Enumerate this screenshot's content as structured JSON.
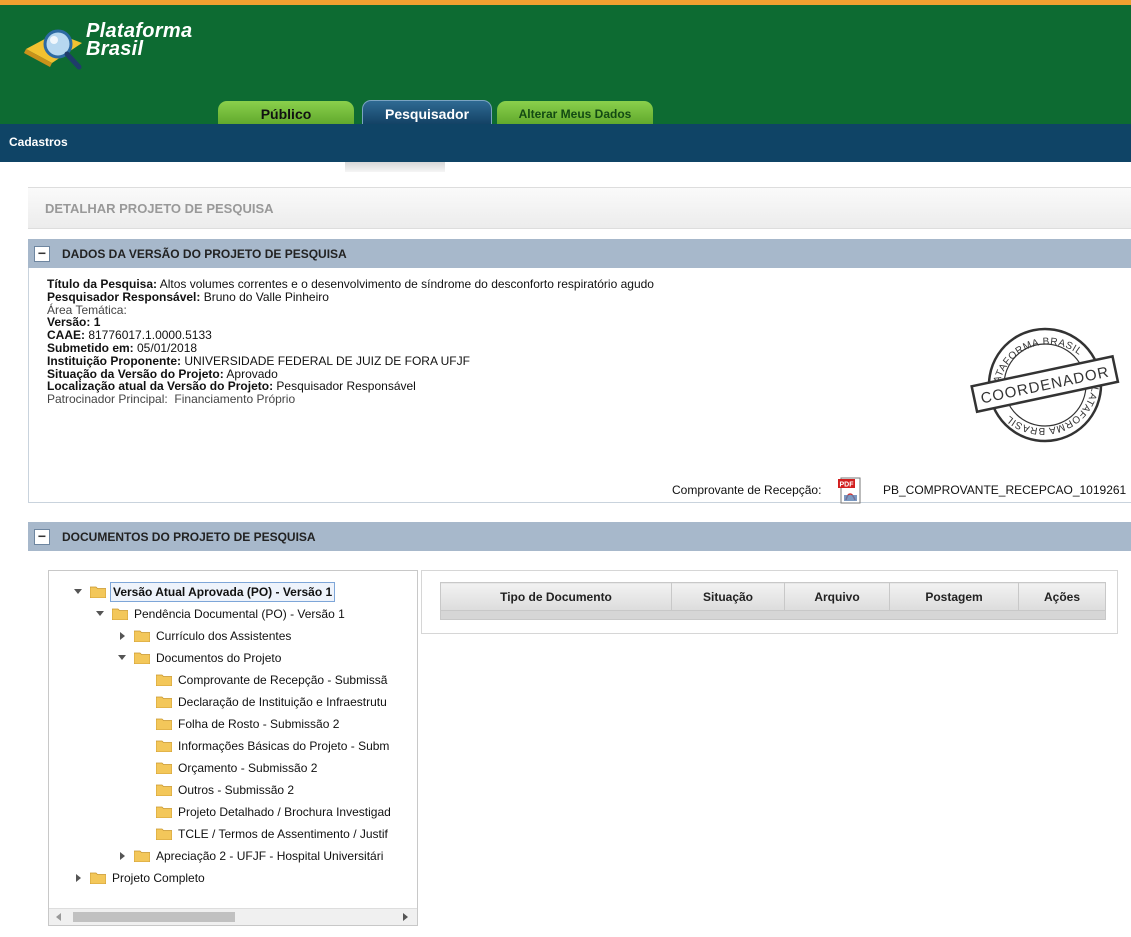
{
  "brand": {
    "name_line1": "Plataforma",
    "name_line2": "Brasil"
  },
  "tabs": [
    {
      "label": "Público"
    },
    {
      "label": "Pesquisador"
    },
    {
      "label": "Alterar Meus Dados"
    }
  ],
  "nav": {
    "item": "Cadastros"
  },
  "page_title": "DETALHAR PROJETO DE PESQUISA",
  "version_panel": {
    "toggle": "−",
    "title": "DADOS DA VERSÃO DO PROJETO DE PESQUISA",
    "fields": {
      "titulo_label": "Título da Pesquisa:",
      "titulo_value": " Altos volumes correntes e o desenvolvimento de síndrome do desconforto respiratório agudo",
      "pesq_label": "Pesquisador Responsável:",
      "pesq_value": " Bruno do Valle Pinheiro",
      "area_label": "Área Temática:",
      "versao_label": "Versão:",
      "versao_value": " 1",
      "caae_label": "CAAE:",
      "caae_value": " 81776017.1.0000.5133",
      "submetido_label": "Submetido em:",
      "submetido_value": " 05/01/2018",
      "inst_label": "Instituição Proponente:",
      "inst_value": " UNIVERSIDADE FEDERAL DE JUIZ DE FORA UFJF",
      "situacao_label": "Situação da Versão do Projeto:",
      "situacao_value": " Aprovado",
      "local_label": "Localização atual da Versão do Projeto:",
      "local_value": " Pesquisador Responsável",
      "patroc_label": "Patrocinador Principal:",
      "patroc_value": "Financiamento Próprio"
    },
    "stamp": {
      "top": "PLATAFORMA BRASIL",
      "center": "COORDENADOR",
      "bottom": "PLATAFORMA BRASIL"
    },
    "receipt_label": "Comprovante de Recepção:",
    "receipt_icon_text": "PDF",
    "receipt_file": "PB_COMPROVANTE_RECEPCAO_1019261"
  },
  "documents_panel": {
    "toggle": "−",
    "title": "DOCUMENTOS DO PROJETO DE PESQUISA",
    "tree": [
      "Versão Atual Aprovada (PO) - Versão 1",
      "Pendência Documental (PO) - Versão 1",
      "Currículo dos Assistentes",
      "Documentos do Projeto",
      "Comprovante de Recepção - Submissã",
      "Declaração de Instituição e Infraestrutu",
      "Folha de Rosto - Submissão 2",
      "Informações Básicas do Projeto - Subm",
      "Orçamento - Submissão 2",
      "Outros - Submissão 2",
      "Projeto Detalhado / Brochura Investigad",
      "TCLE / Termos de Assentimento / Justif",
      "Apreciação 2 - UFJF - Hospital Universitári",
      "Projeto Completo"
    ],
    "table_headers": [
      "Tipo de Documento",
      "Situação",
      "Arquivo",
      "Postagem",
      "Ações"
    ]
  },
  "colors": {
    "header_green": "#0d6b32",
    "nav_blue": "#0f4466",
    "tab_green": "#6cb634",
    "panel_blue": "#a7b8cb",
    "accent_orange": "#f0a030"
  }
}
